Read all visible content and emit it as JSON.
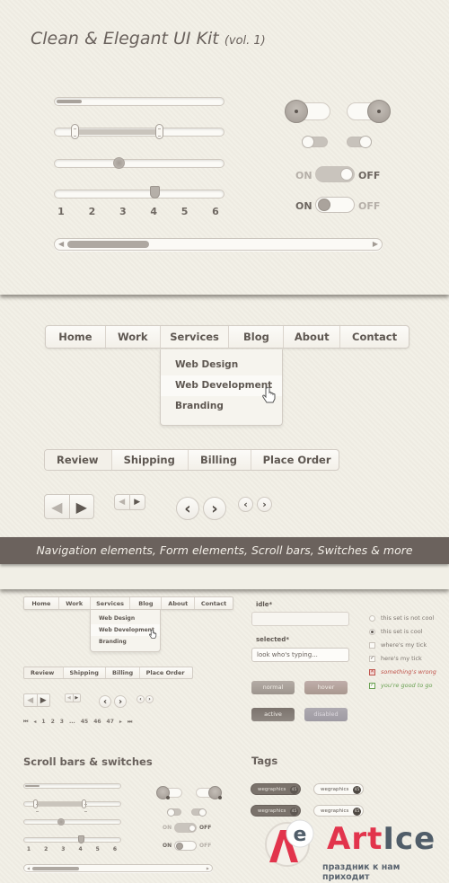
{
  "header": {
    "title": "Clean & Elegant UI Kit",
    "volume": "(vol. 1)"
  },
  "sliders": {
    "progress_fraction": 0.15,
    "range": {
      "low_fraction": 0.12,
      "high_fraction": 0.62
    },
    "single_fraction": 0.38,
    "stepped": {
      "ticks": [
        "1",
        "2",
        "3",
        "4",
        "5",
        "6"
      ],
      "value": "4"
    }
  },
  "switches": {
    "big_left_state": "off",
    "big_right_state": "on",
    "small_left_state": "off",
    "small_right_state": "on",
    "labeled_1": {
      "on_label": "ON",
      "off_label": "OFF",
      "state": "off"
    },
    "labeled_2": {
      "on_label": "ON",
      "off_label": "OFF",
      "state": "on"
    }
  },
  "scrollbar": {
    "thumb_fraction": 0.25,
    "left_arrow": "◀",
    "right_arrow": "▶"
  },
  "nav": {
    "items": [
      {
        "label": "Home"
      },
      {
        "label": "Work"
      },
      {
        "label": "Services"
      },
      {
        "label": "Blog"
      },
      {
        "label": "About"
      },
      {
        "label": "Contact"
      }
    ],
    "active": "Services",
    "dropdown": [
      {
        "label": "Web Design"
      },
      {
        "label": "Web Development"
      },
      {
        "label": "Branding"
      }
    ],
    "hovered": "Web Development"
  },
  "steps": {
    "items": [
      {
        "label": "Review"
      },
      {
        "label": "Shipping"
      },
      {
        "label": "Billing"
      },
      {
        "label": "Place Order"
      }
    ]
  },
  "arrows": {
    "prev": "◀",
    "next": "▶",
    "chev_prev": "‹",
    "chev_next": "›"
  },
  "band": {
    "text": "Navigation elements, Form elements, Scroll bars, Switches & more"
  },
  "pagination": {
    "first": "⏮",
    "prev": "◂",
    "pages": [
      "1",
      "2",
      "3",
      "...",
      "45",
      "46",
      "47"
    ],
    "next": "▸",
    "last": "⏭"
  },
  "form": {
    "idle_label": "idle*",
    "idle_value": "",
    "selected_label": "selected*",
    "selected_value": "look who's typing...",
    "buttons": {
      "normal": "normal",
      "hover": "hover",
      "active": "active",
      "disabled": "disabled"
    },
    "checks": [
      {
        "label": "this set is not cool",
        "type": "radio",
        "checked": false,
        "color": "#7d7670"
      },
      {
        "label": "this set is cool",
        "type": "radio",
        "checked": true,
        "color": "#7d7670"
      },
      {
        "label": "where's my tick",
        "type": "checkbox",
        "checked": false,
        "color": "#7d7670"
      },
      {
        "label": "here's my tick",
        "type": "checkbox",
        "checked": true,
        "color": "#7d7670"
      },
      {
        "label": "something's wrong",
        "type": "checkbox",
        "state": "error",
        "color": "#c0544c"
      },
      {
        "label": "you're good to go",
        "type": "checkbox",
        "state": "success",
        "color": "#6aa153"
      }
    ]
  },
  "headings": {
    "scroll": "Scroll bars & switches",
    "tags": "Tags"
  },
  "tags": [
    {
      "label": "wegraphics",
      "count": "45",
      "style": "dark"
    },
    {
      "label": "wegraphics",
      "count": "45",
      "style": "light"
    },
    {
      "label": "wegraphics",
      "count": "45",
      "style": "dark"
    },
    {
      "label": "wegraphics",
      "count": "45",
      "style": "light"
    }
  ],
  "watermark": {
    "brand_a": "Art",
    "brand_b": "Ice",
    "tagline": "праздник к нам приходит",
    "brand_a_color": "#e2344c",
    "brand_b_color": "#505d69"
  }
}
